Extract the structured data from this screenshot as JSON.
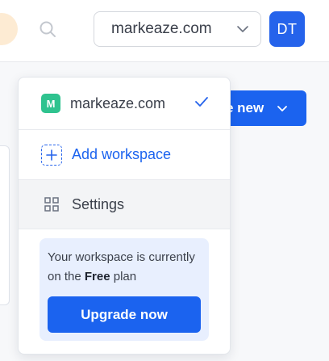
{
  "header": {
    "workspace_selected": "markeaze.com",
    "avatar_initials": "DT",
    "create_button_label": "e new"
  },
  "dropdown": {
    "workspace": {
      "badge": "M",
      "name": "markeaze.com",
      "selected": true
    },
    "add_label": "Add workspace",
    "settings_label": "Settings",
    "plan": {
      "text_prefix": "Your workspace is currently on the",
      "plan_name": "Free",
      "text_suffix": "plan",
      "upgrade_label": "Upgrade now"
    }
  },
  "colors": {
    "primary": "#1b63ef",
    "workspace_badge": "#2fc38f",
    "plan_box_bg": "#e8effe",
    "accent_dot": "#fdebd3"
  },
  "icons": [
    "search-icon",
    "chevron-down-icon",
    "check-icon",
    "plus-icon",
    "grid-icon"
  ]
}
